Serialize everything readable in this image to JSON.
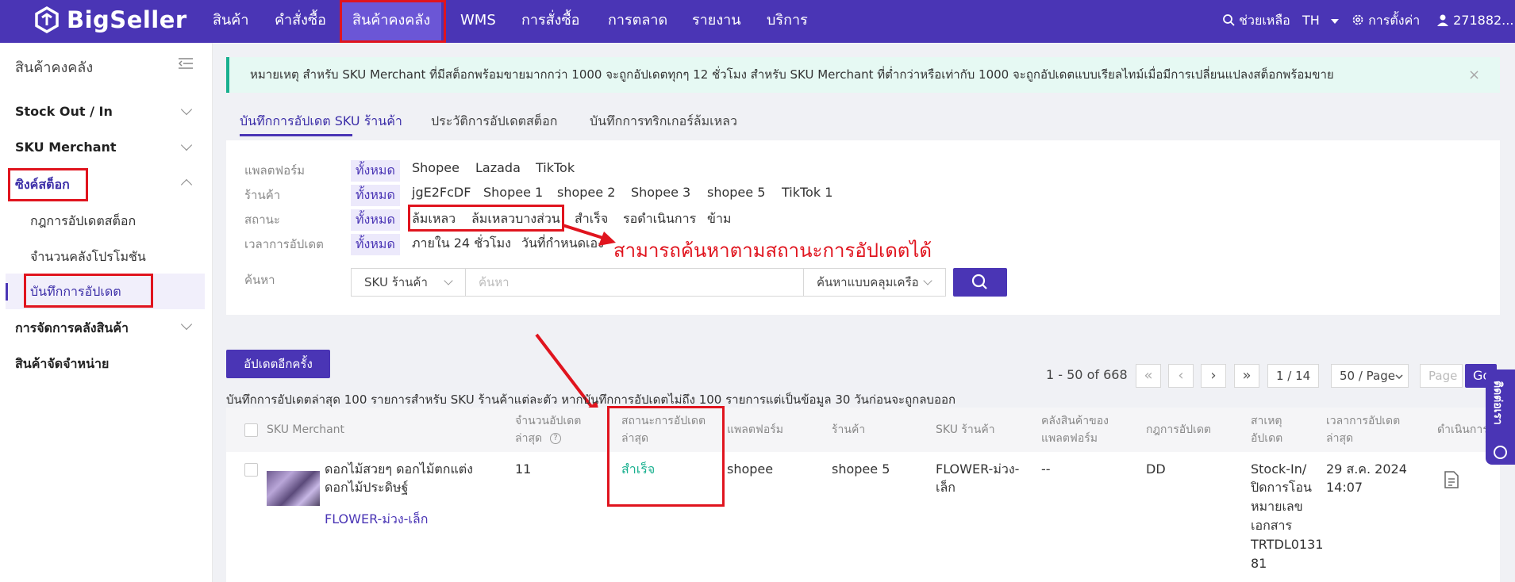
{
  "topbar": {
    "logo": "BigSeller",
    "nav": [
      "สินค้า",
      "คำสั่งซื้อ",
      "สินค้าคงคลัง",
      "WMS",
      "การสั่งซื้อ",
      "การตลาด",
      "รายงาน",
      "บริการ"
    ],
    "help": "ช่วยเหลือ",
    "lang": "TH",
    "settings": "การตั้งค่า",
    "user": "271882..."
  },
  "sidebar": {
    "title": "สินค้าคงคลัง",
    "items": [
      "Stock Out / In",
      "SKU Merchant",
      "ซิงค์สต็อก",
      "การจัดการคลังสินค้า",
      "สินค้าจัดจำหน่าย"
    ],
    "sync_sub": [
      "กฎการอัปเดตสต็อก",
      "จำนวนคลังโปรโมชัน",
      "บันทึกการอัปเดต"
    ]
  },
  "notice": {
    "text": "หมายเหตุ สำหรับ SKU Merchant ที่มีสต็อกพร้อมขายมากกว่า 1000 จะถูกอัปเดตทุกๆ 12 ชั่วโมง สำหรับ SKU Merchant ที่ต่ำกว่าหรือเท่ากับ 1000 จะถูกอัปเดตแบบเรียลไทม์เมื่อมีการเปลี่ยนแปลงสต็อกพร้อมขาย"
  },
  "tabs": [
    "บันทึกการอัปเดต SKU ร้านค้า",
    "ประวัติการอัปเดตสต็อก",
    "บันทึกการทริกเกอร์ล้มเหลว"
  ],
  "filters": {
    "platform_label": "แพลตฟอร์ม",
    "platform": [
      "ทั้งหมด",
      "Shopee",
      "Lazada",
      "TikTok"
    ],
    "store_label": "ร้านค้า",
    "store": [
      "ทั้งหมด",
      "jgE2FcDF",
      "Shopee 1",
      "shopee 2",
      "Shopee 3",
      "shopee 5",
      "TikTok 1"
    ],
    "status_label": "สถานะ",
    "status": [
      "ทั้งหมด",
      "ล้มเหลว",
      "ล้มเหลวบางส่วน",
      "สำเร็จ",
      "รอดำเนินการ",
      "ข้าม"
    ],
    "time_label": "เวลาการอัปเดต",
    "time": [
      "ทั้งหมด",
      "ภายใน 24 ชั่วโมง",
      "วันที่กำหนดเอง"
    ],
    "search_label": "ค้นหา",
    "search_field": "SKU ร้านค้า",
    "search_placeholder": "ค้นหา",
    "search_mode": "ค้นหาแบบคลุมเครือ"
  },
  "annotation": "สามารถค้นหาตามสถานะการอัปเดตได้",
  "toolbar": {
    "reupdate": "อัปเดตอีกครั้ง",
    "range": "1 - 50 of 668",
    "page": "1 / 14",
    "per_page": "50 / Page",
    "page_input": "Page",
    "go": "Go"
  },
  "hint": "บันทึกการอัปเดตล่าสุด 100 รายการสำหรับ SKU ร้านค้าแต่ละตัว หากบันทึกการอัปเดตไม่ถึง 100 รายการแต่เป็นข้อมูล 30 วันก่อนจะถูกลบออก",
  "table": {
    "headers": {
      "sku_merchant": "SKU Merchant",
      "qty_1": "จำนวนอัปเดต",
      "qty_2": "ล่าสุด",
      "status_1": "สถานะการอัปเดต",
      "status_2": "ล่าสุด",
      "platform": "แพลตฟอร์ม",
      "store": "ร้านค้า",
      "store_sku": "SKU ร้านค้า",
      "wh_1": "คลังสินค้าของ",
      "wh_2": "แพลตฟอร์ม",
      "rule": "กฎการอัปเดต",
      "reason_1": "สาเหตุ",
      "reason_2": "อัปเดต",
      "time_1": "เวลาการอัปเดต",
      "time_2": "ล่าสุด",
      "action": "ดำเนินการ"
    },
    "row": {
      "name_1": "ดอกไม้สวยๆ ดอกไม้ตกแต่ง",
      "name_2": "ดอกไม้ประดิษฐ์",
      "sku": "FLOWER-ม่วง-เล็ก",
      "qty": "11",
      "status": "สำเร็จ",
      "platform": "shopee",
      "store": "shopee 5",
      "store_sku_1": "FLOWER-ม่วง-",
      "store_sku_2": "เล็ก",
      "warehouse": "--",
      "rule": "DD",
      "reason": [
        "Stock-In/",
        "ปิดการโอน",
        "หมายเลข",
        "เอกสาร",
        "TRTDL0131",
        "81"
      ],
      "time_1": "29 ส.ค. 2024",
      "time_2": "14:07"
    }
  },
  "side_float": "ติดต่อเรา"
}
